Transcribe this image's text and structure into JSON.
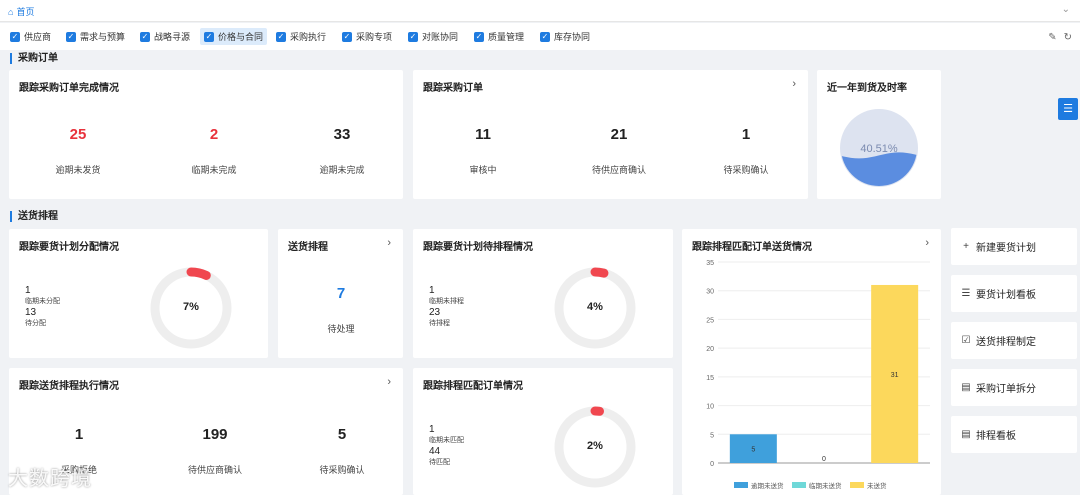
{
  "topbar": {
    "home": "首页"
  },
  "filters": [
    {
      "label": "供应商"
    },
    {
      "label": "需求与预算"
    },
    {
      "label": "战略寻源"
    },
    {
      "label": "价格与合同"
    },
    {
      "label": "采购执行"
    },
    {
      "label": "采购专项"
    },
    {
      "label": "对账协同"
    },
    {
      "label": "质量管理"
    },
    {
      "label": "库存协同"
    }
  ],
  "sections": {
    "purchase": "采购订单",
    "delivery": "送货排程"
  },
  "card_order_complete": {
    "title": "跟踪采购订单完成情况",
    "stats": [
      {
        "value": "25",
        "label": "逾期未发货"
      },
      {
        "value": "2",
        "label": "临期未完成"
      },
      {
        "value": "33",
        "label": "逾期未完成"
      }
    ]
  },
  "card_track_order": {
    "title": "跟踪采购订单",
    "stats": [
      {
        "value": "11",
        "label": "审核中"
      },
      {
        "value": "21",
        "label": "待供应商确认"
      },
      {
        "value": "1",
        "label": "待采购确认"
      }
    ]
  },
  "card_ontime": {
    "title": "近一年到货及时率",
    "percent": "40.51%",
    "fraction": 0.4051
  },
  "card_plan_alloc": {
    "title": "跟踪要货计划分配情况",
    "v1": "1",
    "l1": "临期未分配",
    "v2": "13",
    "l2": "待分配",
    "percent": "7%",
    "fraction": 0.07
  },
  "card_schedule": {
    "title": "送货排程",
    "value": "7",
    "label": "待处理"
  },
  "card_plan_pending": {
    "title": "跟踪要货计划待排程情况",
    "v1": "1",
    "l1": "临期未排程",
    "v2": "23",
    "l2": "待排程",
    "percent": "4%",
    "fraction": 0.04
  },
  "card_exec": {
    "title": "跟踪送货排程执行情况",
    "stats": [
      {
        "value": "1",
        "label": "采购拒绝"
      },
      {
        "value": "199",
        "label": "待供应商确认"
      },
      {
        "value": "5",
        "label": "待采购确认"
      }
    ]
  },
  "card_match": {
    "title": "跟踪排程匹配订单情况",
    "v1": "1",
    "l1": "临期未匹配",
    "v2": "44",
    "l2": "待匹配",
    "percent": "2%",
    "fraction": 0.02
  },
  "card_chart": {
    "title": "跟踪排程匹配订单送货情况"
  },
  "chart_data": {
    "type": "bar",
    "categories": [
      "逾期未送货",
      "临期未送货",
      "未送货"
    ],
    "values": [
      5,
      0,
      31
    ],
    "series_colors": [
      "#3fa0dc",
      "#6fd8d8",
      "#fcd85c"
    ],
    "ylim": [
      0,
      35
    ],
    "yticks": [
      "0",
      "5",
      "10",
      "15",
      "20",
      "25",
      "30",
      "35"
    ],
    "legend": [
      "逾期未送货",
      "临期未送货",
      "未送货"
    ],
    "data_labels": [
      "5",
      "0",
      "31"
    ]
  },
  "side_buttons": [
    {
      "icon": "+",
      "label": "新建要货计划"
    },
    {
      "icon": "☰",
      "label": "要货计划看板"
    },
    {
      "icon": "☑",
      "label": "送货排程制定"
    },
    {
      "icon": "▤",
      "label": "采购订单拆分"
    },
    {
      "icon": "▤",
      "label": "排程看板"
    }
  ],
  "watermark": "大数跨境",
  "colors": {
    "accent": "#1e7be0",
    "red": "#e8323c",
    "ring_track": "#eeeeee",
    "ring_fill": "#f0474f",
    "wave": "#5b8de0"
  }
}
